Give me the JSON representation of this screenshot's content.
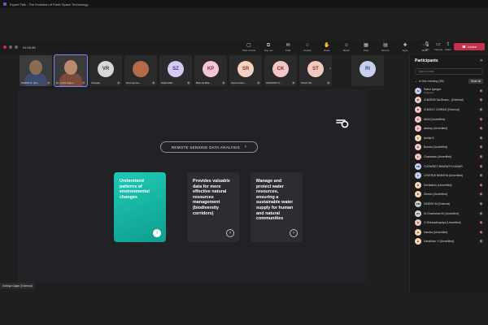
{
  "window": {
    "title": "Expert Talk - The Evolution of Earth Space Technology"
  },
  "toolbar": {
    "timer": "01:03:45",
    "tools": [
      {
        "label": "Take control",
        "icon": "take-control-icon",
        "glyph": "▢"
      },
      {
        "label": "Pop out",
        "icon": "pop-out-icon",
        "glyph": "⧉"
      },
      {
        "label": "Chat",
        "icon": "chat-icon",
        "glyph": "✉"
      },
      {
        "label": "People",
        "icon": "people-icon",
        "glyph": "☺"
      },
      {
        "label": "Raise",
        "icon": "raise-hand-icon",
        "glyph": "✋"
      },
      {
        "label": "React",
        "icon": "react-icon",
        "glyph": "☺"
      },
      {
        "label": "View",
        "icon": "view-icon",
        "glyph": "▦"
      },
      {
        "label": "Rooms",
        "icon": "rooms-icon",
        "glyph": "▤"
      },
      {
        "label": "Apps",
        "icon": "apps-icon",
        "glyph": "✚"
      },
      {
        "label": "More",
        "icon": "more-icon",
        "glyph": "⋯"
      }
    ],
    "mic_label": "Mic",
    "camera_label": "Camera",
    "share_label": "Share",
    "leave_label": "Leave"
  },
  "strip": {
    "tiles": [
      {
        "type": "video",
        "name": "VARUN S. (Gu...",
        "face": "#8a6b54",
        "shirt": "#3d4b6b"
      },
      {
        "type": "video",
        "name": "Dr. Latha Sujee...",
        "face": "#b98a6f",
        "shirt": "#7a4a3a"
      },
      {
        "type": "avatar",
        "initials": "VR",
        "name": "Vinayak...",
        "bg": "#d7d7d7",
        "fg": "#3a3a3a"
      },
      {
        "type": "photo",
        "initials": "",
        "name": "Soumya Gu...",
        "bg": "#b56a4a",
        "fg": "#ffffff"
      },
      {
        "type": "avatar",
        "initials": "SZ",
        "name": "Shaik Mah...",
        "bg": "#d6c8f2",
        "fg": "#4a3a78"
      },
      {
        "type": "avatar",
        "initials": "KP",
        "name": "Bhavna Bha...",
        "bg": "#f4c7d8",
        "fg": "#7a2d4a"
      },
      {
        "type": "avatar",
        "initials": "SR",
        "name": "Suman Ram...",
        "bg": "#f6d2c2",
        "fg": "#7a3a22"
      },
      {
        "type": "avatar",
        "initials": "CK",
        "name": "CHINMAYI K...",
        "bg": "#f6c6c6",
        "fg": "#7a2222"
      },
      {
        "type": "avatar",
        "initials": "ST",
        "name": "Shruti Tiw...",
        "bg": "#f3c9c0",
        "fg": "#7a3324"
      }
    ],
    "extra_initials": "RI"
  },
  "slide": {
    "pill_label": "REMOTE SENSING DATA ANALYSIS",
    "cards": [
      {
        "text": "Understand patterns of environmental changes",
        "highlighted": true
      },
      {
        "text": "Provides valuable data for more effective natural resources management (biodiversity corridors)",
        "highlighted": false
      },
      {
        "text": "Manage and protect water resources, ensuring a sustainable water supply for human and natural communities",
        "highlighted": false
      }
    ]
  },
  "presenter_label": "Sothiya Gajan (External)",
  "panel": {
    "title": "Participants",
    "search_placeholder": "Type a name",
    "section_label": "In this meeting (85)",
    "mute_all": "Mute all",
    "people": [
      {
        "initials": "SI",
        "name": "Rahul Iyengar",
        "sub": "Organiser",
        "color": "#c7d0f5"
      },
      {
        "initials": "2I",
        "name": "21NSE09 Sai Bhara... (External)",
        "sub": "",
        "color": "#f4c4c4"
      },
      {
        "initials": "2I",
        "name": "21NS017 CHIRAG (External)",
        "sub": "",
        "color": "#f4c4c4"
      },
      {
        "initials": "A",
        "name": "Abhil (Unverified)",
        "sub": "",
        "color": "#f4c4c4"
      },
      {
        "initials": "A",
        "name": "akshay (Unverified)",
        "sub": "",
        "color": "#f4c4c4"
      },
      {
        "initials": "A",
        "name": "Ankita S",
        "sub": "",
        "color": "#f6d6b6"
      },
      {
        "initials": "B",
        "name": "Bombs (Unverified)",
        "sub": "",
        "color": "#f4c4c4"
      },
      {
        "initials": "C",
        "name": "Chandana (Unverified)",
        "sub": "",
        "color": "#f4c4c4"
      },
      {
        "initials": "CB",
        "name": "CHOWDEY BHARATH KUMAR",
        "sub": "",
        "color": "#c7d0f5"
      },
      {
        "initials": "C",
        "name": "CH4TB15 NIMISHA (Unverified)",
        "sub": "",
        "color": "#c7d0f5"
      },
      {
        "initials": "D",
        "name": "Devikabhu (Unverified)",
        "sub": "",
        "color": "#f6d6b6"
      },
      {
        "initials": "D",
        "name": "Dinesh (Unverified)",
        "sub": "",
        "color": "#f6d6b6"
      },
      {
        "initials": "DM",
        "name": "DINESH M (External)",
        "sub": "",
        "color": "#c9c9c9"
      },
      {
        "initials": "DS",
        "name": "Dr Dineeshan M (Unverified)",
        "sub": "",
        "color": "#d8d8d8"
      },
      {
        "initials": "G",
        "name": "G.Dhinsadhupriya (Unverified)",
        "sub": "",
        "color": "#f4c4c4"
      },
      {
        "initials": "H",
        "name": "Harsha (Unverified)",
        "sub": "",
        "color": "#f6d6b6"
      },
      {
        "initials": "H",
        "name": "Harshitha. V (Unverified)",
        "sub": "",
        "color": "#f6d6b6"
      }
    ]
  }
}
